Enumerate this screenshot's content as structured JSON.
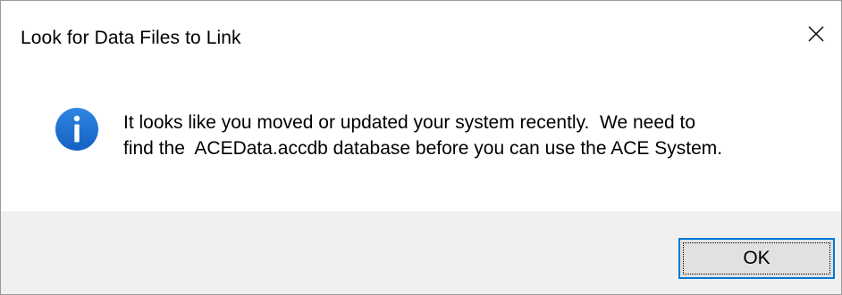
{
  "window": {
    "title": "Look for Data Files to Link"
  },
  "titlebar": {
    "close_icon": "close-icon"
  },
  "message": {
    "icon": "information-icon",
    "lines": [
      "It looks like you moved or updated your system recently.  We need to",
      "find the  ACEData.accdb database before you can use the ACE System."
    ]
  },
  "buttons": {
    "ok_label": "OK"
  },
  "colors": {
    "info_icon": "#1a6fd3",
    "button_border": "#0078d7",
    "footer_background": "#f0f0f0"
  }
}
